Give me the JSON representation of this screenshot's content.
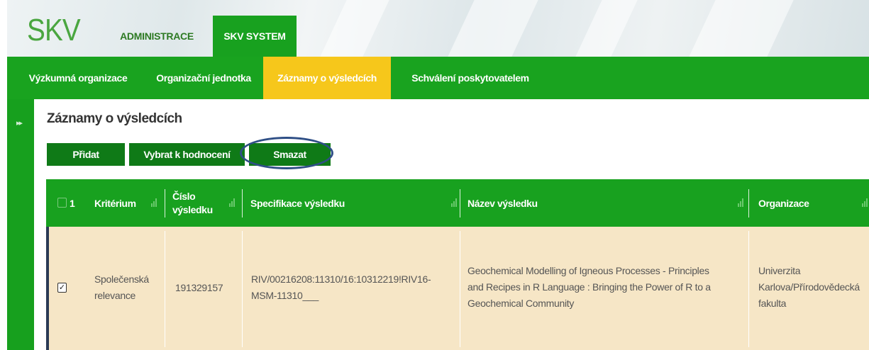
{
  "header": {
    "logo": "SKV",
    "tabs": [
      {
        "label": "ADMINISTRACE",
        "active": false
      },
      {
        "label": "SKV SYSTEM",
        "active": true
      }
    ]
  },
  "nav": {
    "items": [
      {
        "label": "Výzkumná organizace",
        "active": false
      },
      {
        "label": "Organizační jednotka",
        "active": false
      },
      {
        "label": "Záznamy o výsledcích",
        "active": true
      },
      {
        "label": "Schválení poskytovatelem",
        "active": false
      }
    ]
  },
  "sidebar": {
    "toggle_icon": "double-chevron-right-icon",
    "toggle_glyph": "▸▸"
  },
  "page": {
    "title": "Záznamy o výsledcích"
  },
  "toolbar": {
    "add_label": "Přidat",
    "select_label": "Vybrat k hodnocení",
    "delete_label": "Smazat"
  },
  "table": {
    "selected_count": "1",
    "columns": [
      {
        "label": "Kritérium"
      },
      {
        "label": "Číslo výsledku",
        "line1": "Číslo",
        "line2": "výsledku"
      },
      {
        "label": "Specifikace výsledku"
      },
      {
        "label": "Název výsledku"
      },
      {
        "label": "Organizace"
      }
    ],
    "rows": [
      {
        "checked": true,
        "check_glyph": "✓",
        "criterion_l1": "Společenská",
        "criterion_l2": "relevance",
        "number": "191329157",
        "spec_l1": "RIV/00216208:11310/16:10312219!RIV16-",
        "spec_l2": "MSM-11310___",
        "name_l1": "Geochemical Modelling of Igneous Processes - Principles",
        "name_l2": "and Recipes in R Language : Bringing the Power of R to a",
        "name_l3": "Geochemical Community",
        "org_l1": "Univerzita",
        "org_l2": "Karlova/Přírodovědecká",
        "org_l3": "fakulta"
      }
    ]
  },
  "colors": {
    "brand_green": "#19a31f",
    "dark_green_button": "#0f7a17",
    "active_tab_yellow": "#f6c71b",
    "selected_row": "#f6e6c6",
    "highlight_ring": "#2f4f86"
  }
}
